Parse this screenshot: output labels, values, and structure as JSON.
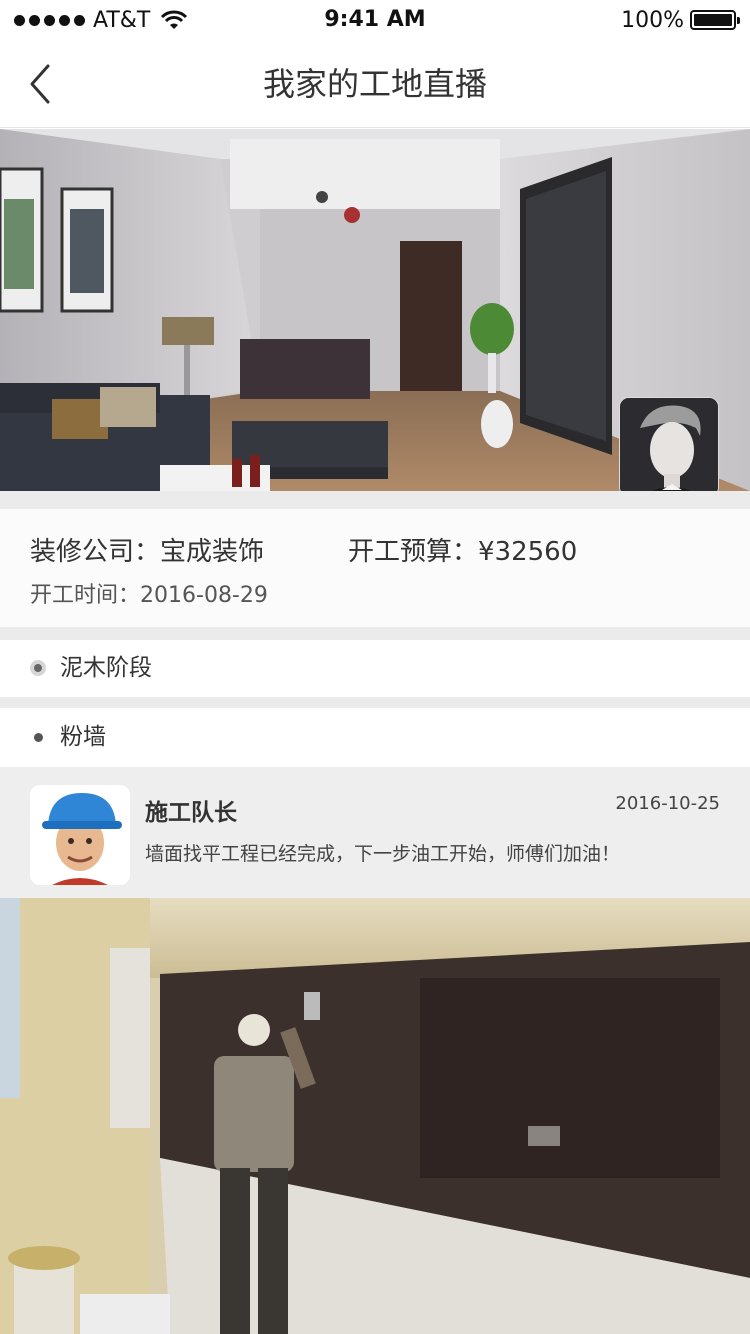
{
  "status_bar": {
    "carrier": "AT&T",
    "time": "9:41 AM",
    "battery": "100%",
    "battery_level": 1.0
  },
  "nav": {
    "title": "我家的工地直播",
    "back_icon": "chevron-left-icon"
  },
  "info": {
    "company_label": "装修公司：",
    "company_value": "宝成装饰",
    "budget_label": "开工预算：",
    "budget_value": "¥32560",
    "start_label": "开工时间：",
    "start_value": "2016-08-29"
  },
  "stages": [
    {
      "label": "泥木阶段"
    },
    {
      "label": "粉墙"
    }
  ],
  "post": {
    "author": "施工队长",
    "date": "2016-10-25",
    "text": "墙面找平工程已经完成，下一步油工开始，师傅们加油！"
  },
  "colors": {
    "background": "#ffffff",
    "band": "#ebebeb",
    "post_bg": "#eeeeee",
    "text": "#333333"
  }
}
